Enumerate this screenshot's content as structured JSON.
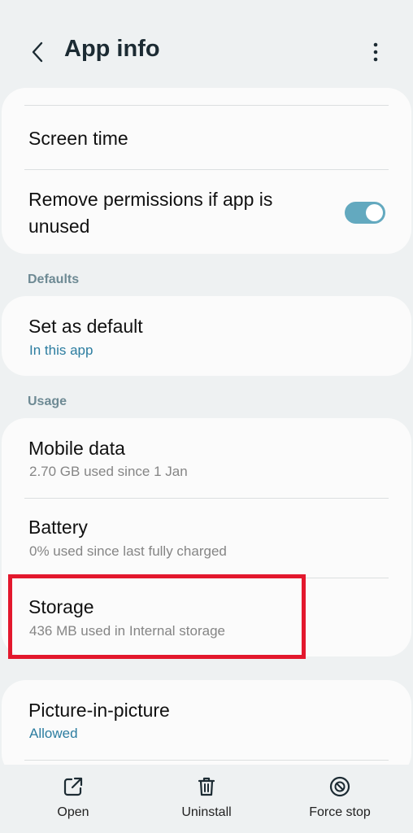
{
  "header": {
    "title": "App info"
  },
  "card1": {
    "screen_time": "Screen time",
    "remove_permissions_line1": "Remove permissions if app is",
    "remove_permissions_line2": "unused"
  },
  "sections": {
    "defaults": "Defaults",
    "usage": "Usage"
  },
  "defaults_card": {
    "title": "Set as default",
    "subtitle": "In this app"
  },
  "usage_card": {
    "mobile_data": {
      "title": "Mobile data",
      "subtitle": "2.70 GB used since 1 Jan"
    },
    "battery": {
      "title": "Battery",
      "subtitle": "0% used since last fully charged"
    },
    "storage": {
      "title": "Storage",
      "subtitle": "436 MB used in Internal storage"
    }
  },
  "pip_card": {
    "title": "Picture-in-picture",
    "subtitle": "Allowed"
  },
  "bottom_bar": {
    "open": "Open",
    "uninstall": "Uninstall",
    "force_stop": "Force stop"
  },
  "colors": {
    "accent": "#2c7da0",
    "toggle_on": "#63a9bf",
    "highlight": "#e3182d"
  },
  "toggle_state": "on"
}
